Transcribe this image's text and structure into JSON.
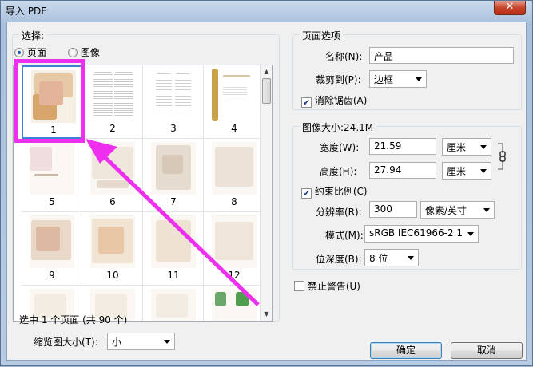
{
  "window": {
    "title": "导入 PDF",
    "close_label": "✕"
  },
  "select_group": {
    "legend": "选择:",
    "radio_pages": "页面",
    "radio_images": "图像",
    "thumbnails": [
      {
        "num": "1"
      },
      {
        "num": "2"
      },
      {
        "num": "3"
      },
      {
        "num": "4"
      },
      {
        "num": "5"
      },
      {
        "num": "6"
      },
      {
        "num": "7"
      },
      {
        "num": "8"
      },
      {
        "num": "9"
      },
      {
        "num": "10"
      },
      {
        "num": "11"
      },
      {
        "num": "12"
      }
    ],
    "selection_status": "选中 1 个页面 (共 90 个)",
    "thumb_size_label": "缩览图大小(T):",
    "thumb_size_value": "小"
  },
  "page_options": {
    "legend": "页面选项",
    "name_label": "名称(N):",
    "name_value": "产品",
    "crop_label": "裁剪到(P):",
    "crop_value": "边框",
    "antialias_label": "消除锯齿(A)"
  },
  "image_size": {
    "legend": "图像大小:24.1M",
    "width_label": "宽度(W):",
    "width_value": "21.59",
    "width_unit": "厘米",
    "height_label": "高度(H):",
    "height_value": "27.94",
    "height_unit": "厘米",
    "constrain_label": "约束比例(C)",
    "resolution_label": "分辨率(R):",
    "resolution_value": "300",
    "resolution_unit": "像素/英寸",
    "mode_label": "模式(M):",
    "mode_value": "sRGB IEC61966-2.1",
    "depth_label": "位深度(B):",
    "depth_value": "8 位"
  },
  "suppress_warnings_label": "禁止警告(U)",
  "buttons": {
    "ok": "确定",
    "cancel": "取消"
  },
  "colors": {
    "highlight": "#ee2ff0",
    "selection": "#3b81d6"
  }
}
